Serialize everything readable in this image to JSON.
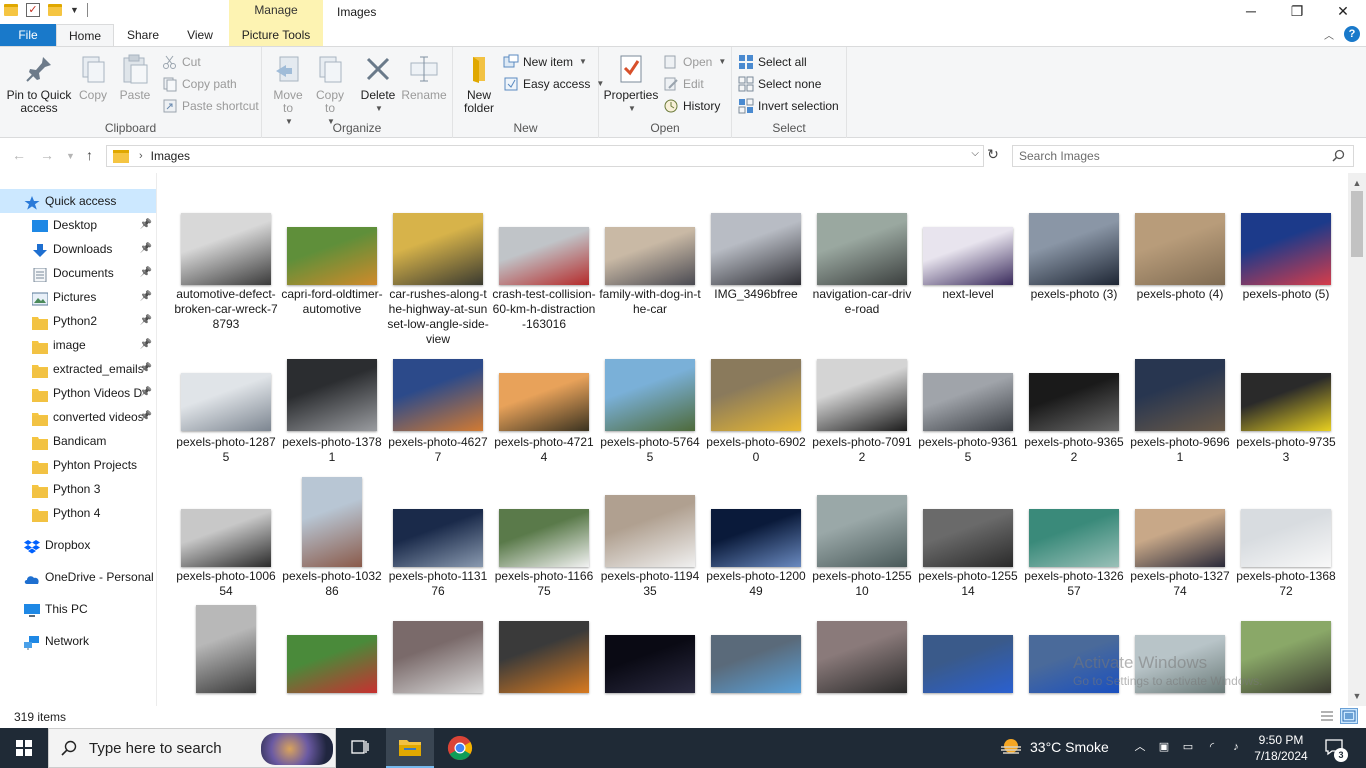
{
  "window": {
    "title": "Images",
    "context_tab": "Manage",
    "controls": {
      "minimize": "─",
      "maximize": "❐",
      "close": "✕"
    }
  },
  "ribbon_tabs": {
    "file": "File",
    "home": "Home",
    "share": "Share",
    "view": "View",
    "picture_tools": "Picture Tools"
  },
  "ribbon": {
    "clipboard": {
      "label": "Clipboard",
      "pin": "Pin to Quick access",
      "copy": "Copy",
      "paste": "Paste",
      "cut": "Cut",
      "copy_path": "Copy path",
      "paste_shortcut": "Paste shortcut"
    },
    "organize": {
      "label": "Organize",
      "move_to": "Move to",
      "copy_to": "Copy to",
      "delete": "Delete",
      "rename": "Rename"
    },
    "new": {
      "label": "New",
      "new_folder": "New folder",
      "new_item": "New item",
      "easy_access": "Easy access"
    },
    "open": {
      "label": "Open",
      "properties": "Properties",
      "open": "Open",
      "edit": "Edit",
      "history": "History"
    },
    "select": {
      "label": "Select",
      "select_all": "Select all",
      "select_none": "Select none",
      "invert": "Invert selection"
    }
  },
  "address": {
    "path": "Images",
    "search_placeholder": "Search Images"
  },
  "nav": [
    {
      "label": "Quick access",
      "icon": "star-icon",
      "indent": 1,
      "pinned": false,
      "selected": true
    },
    {
      "label": "Desktop",
      "icon": "desktop-icon",
      "indent": 2,
      "pinned": true
    },
    {
      "label": "Downloads",
      "icon": "download-icon",
      "indent": 2,
      "pinned": true
    },
    {
      "label": "Documents",
      "icon": "documents-icon",
      "indent": 2,
      "pinned": true
    },
    {
      "label": "Pictures",
      "icon": "pictures-icon",
      "indent": 2,
      "pinned": true
    },
    {
      "label": "Python2",
      "icon": "folder-icon",
      "indent": 2,
      "pinned": true
    },
    {
      "label": "image",
      "icon": "folder-icon",
      "indent": 2,
      "pinned": true
    },
    {
      "label": "extracted_emails",
      "icon": "folder-icon",
      "indent": 2,
      "pinned": true
    },
    {
      "label": "Python Videos D",
      "icon": "folder-icon",
      "indent": 2,
      "pinned": true
    },
    {
      "label": "converted videos",
      "icon": "folder-icon",
      "indent": 2,
      "pinned": true
    },
    {
      "label": "Bandicam",
      "icon": "folder-icon",
      "indent": 2,
      "pinned": false
    },
    {
      "label": "Pyhton Projects",
      "icon": "folder-icon",
      "indent": 2,
      "pinned": false
    },
    {
      "label": "Python 3",
      "icon": "folder-icon",
      "indent": 2,
      "pinned": false
    },
    {
      "label": "Python 4",
      "icon": "folder-icon",
      "indent": 2,
      "pinned": false
    },
    {
      "label": "Dropbox",
      "icon": "dropbox-icon",
      "indent": 1,
      "pinned": false,
      "gap": true
    },
    {
      "label": "OneDrive - Personal",
      "icon": "onedrive-icon",
      "indent": 1,
      "pinned": false,
      "gap": true
    },
    {
      "label": "This PC",
      "icon": "computer-icon",
      "indent": 1,
      "pinned": false,
      "gap": true
    },
    {
      "label": "Network",
      "icon": "network-icon",
      "indent": 1,
      "pinned": false,
      "gap": true
    }
  ],
  "files": [
    [
      {
        "name": "automotive-defect-broken-car-wreck-78793",
        "colors": [
          "#d8d8d8",
          "#3a3a3a"
        ],
        "shape": "landscape"
      },
      {
        "name": "capri-ford-oldtimer-automotive",
        "colors": [
          "#5f8f3a",
          "#d08a2a"
        ],
        "shape": "wide"
      },
      {
        "name": "car-rushes-along-the-highway-at-sunset-low-angle-side-view",
        "colors": [
          "#d7b34a",
          "#3a3a30"
        ],
        "shape": "landscape"
      },
      {
        "name": "crash-test-collision-60-km-h-distraction-163016",
        "colors": [
          "#c0c4c8",
          "#b52b2b"
        ],
        "shape": "wide"
      },
      {
        "name": "family-with-dog-in-the-car",
        "colors": [
          "#c9b9a5",
          "#4a4a52"
        ],
        "shape": "wide"
      },
      {
        "name": "IMG_3496bfree",
        "colors": [
          "#b8bcc4",
          "#2e2e34"
        ],
        "shape": "landscape"
      },
      {
        "name": "navigation-car-drive-road",
        "colors": [
          "#9aa8a0",
          "#3b3f3e"
        ],
        "shape": "landscape"
      },
      {
        "name": "next-level",
        "colors": [
          "#e8e4ee",
          "#3a2b5c"
        ],
        "shape": "wide"
      },
      {
        "name": "pexels-photo (3)",
        "colors": [
          "#8a96a6",
          "#1e2634"
        ],
        "shape": "landscape"
      },
      {
        "name": "pexels-photo (4)",
        "colors": [
          "#b89c7a",
          "#7f6b52"
        ],
        "shape": "landscape"
      },
      {
        "name": "pexels-photo (5)",
        "colors": [
          "#1c3a8a",
          "#d63c4a"
        ],
        "shape": "landscape"
      }
    ],
    [
      {
        "name": "pexels-photo-12875",
        "colors": [
          "#e0e4e8",
          "#7c8590"
        ],
        "shape": "wide"
      },
      {
        "name": "pexels-photo-13781",
        "colors": [
          "#2b2d30",
          "#9a9ca0"
        ],
        "shape": "landscape"
      },
      {
        "name": "pexels-photo-46277",
        "colors": [
          "#2c4a8a",
          "#d27a32"
        ],
        "shape": "landscape"
      },
      {
        "name": "pexels-photo-47214",
        "colors": [
          "#e8a25a",
          "#3a3220"
        ],
        "shape": "wide"
      },
      {
        "name": "pexels-photo-57645",
        "colors": [
          "#7ab0d8",
          "#4e6a3a"
        ],
        "shape": "landscape"
      },
      {
        "name": "pexels-photo-69020",
        "colors": [
          "#8a7a5c",
          "#e8b832"
        ],
        "shape": "landscape"
      },
      {
        "name": "pexels-photo-70912",
        "colors": [
          "#d4d4d4",
          "#1c1c1c"
        ],
        "shape": "landscape"
      },
      {
        "name": "pexels-photo-93615",
        "colors": [
          "#a0a4aa",
          "#3a3e44"
        ],
        "shape": "wide"
      },
      {
        "name": "pexels-photo-93652",
        "colors": [
          "#1a1a1a",
          "#6a6a6a"
        ],
        "shape": "wide"
      },
      {
        "name": "pexels-photo-96961",
        "colors": [
          "#283650",
          "#6a5a48"
        ],
        "shape": "landscape"
      },
      {
        "name": "pexels-photo-97353",
        "colors": [
          "#2a2a2a",
          "#e8d020"
        ],
        "shape": "wide"
      }
    ],
    [
      {
        "name": "pexels-photo-100654",
        "colors": [
          "#c8c8c8",
          "#2a2a2a"
        ],
        "shape": "wide"
      },
      {
        "name": "pexels-photo-103286",
        "colors": [
          "#b8c6d4",
          "#8a5a4a"
        ],
        "shape": "portrait"
      },
      {
        "name": "pexels-photo-113176",
        "colors": [
          "#1a2a4a",
          "#8a9ab0"
        ],
        "shape": "wide"
      },
      {
        "name": "pexels-photo-116675",
        "colors": [
          "#5a7a4a",
          "#f2f2f2"
        ],
        "shape": "wide"
      },
      {
        "name": "pexels-photo-119435",
        "colors": [
          "#b0a090",
          "#f0f0f0"
        ],
        "shape": "landscape"
      },
      {
        "name": "pexels-photo-120049",
        "colors": [
          "#0a1a3a",
          "#6a8ac0"
        ],
        "shape": "wide"
      },
      {
        "name": "pexels-photo-125510",
        "colors": [
          "#9aa8a8",
          "#4a5a5a"
        ],
        "shape": "landscape"
      },
      {
        "name": "pexels-photo-125514",
        "colors": [
          "#6a6a6a",
          "#2a2a2a"
        ],
        "shape": "wide"
      },
      {
        "name": "pexels-photo-132657",
        "colors": [
          "#3a8a7a",
          "#9ac0b8"
        ],
        "shape": "wide"
      },
      {
        "name": "pexels-photo-132774",
        "colors": [
          "#c8a888",
          "#2a2a3a"
        ],
        "shape": "wide"
      },
      {
        "name": "pexels-photo-136872",
        "colors": [
          "#d8dce0",
          "#f8f8f8"
        ],
        "shape": "wide"
      }
    ],
    [
      {
        "name": "",
        "colors": [
          "#b8b8b8",
          "#3a3a3a"
        ],
        "shape": "portrait-sm"
      },
      {
        "name": "",
        "colors": [
          "#4a8a3a",
          "#c83030"
        ],
        "shape": "wide"
      },
      {
        "name": "",
        "colors": [
          "#7a6a6a",
          "#d8d8d8"
        ],
        "shape": "landscape"
      },
      {
        "name": "",
        "colors": [
          "#3a3a3a",
          "#d87a20"
        ],
        "shape": "landscape"
      },
      {
        "name": "",
        "colors": [
          "#0a0a14",
          "#2a2a40"
        ],
        "shape": "wide"
      },
      {
        "name": "",
        "colors": [
          "#5a6a7a",
          "#5aa0d8"
        ],
        "shape": "wide"
      },
      {
        "name": "",
        "colors": [
          "#8a7a7a",
          "#2a2a2a"
        ],
        "shape": "landscape"
      },
      {
        "name": "",
        "colors": [
          "#3a5a8a",
          "#2a60d0"
        ],
        "shape": "wide"
      },
      {
        "name": "",
        "colors": [
          "#4a6a9a",
          "#1a50c0"
        ],
        "shape": "wide"
      },
      {
        "name": "",
        "colors": [
          "#b8c4c8",
          "#6a7a78"
        ],
        "shape": "wide"
      },
      {
        "name": "",
        "colors": [
          "#8aa868",
          "#3a3a30"
        ],
        "shape": "landscape"
      }
    ]
  ],
  "watermark": {
    "title": "Activate Windows",
    "subtitle": "Go to Settings to activate Windows."
  },
  "status": {
    "item_count": "319 items"
  },
  "taskbar": {
    "search_placeholder": "Type here to search",
    "weather": "33°C  Smoke",
    "time": "9:50 PM",
    "date": "7/18/2024",
    "notification_count": "3"
  },
  "colors": {
    "accent": "#1979ca",
    "selection": "#cce8ff",
    "manage_tab": "#fdf3b2",
    "taskbar": "#1f2a36"
  }
}
